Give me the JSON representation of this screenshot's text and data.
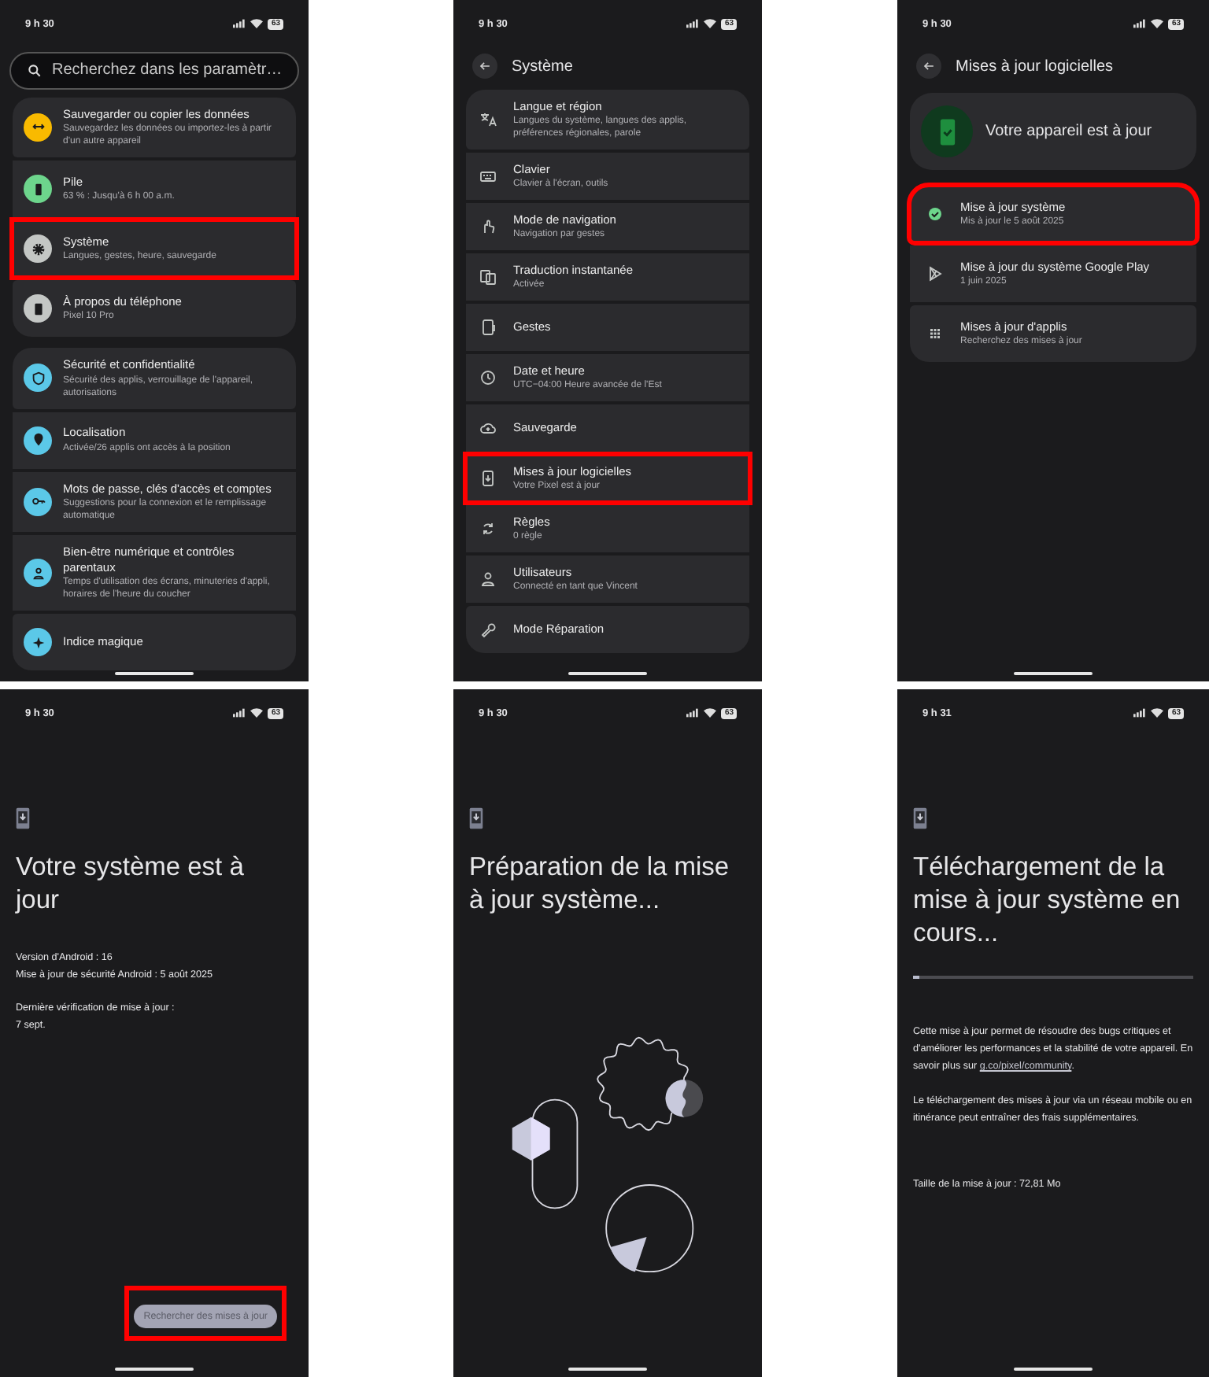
{
  "screens": [
    {
      "kind": "settings",
      "time": "9 h 30",
      "battery": "63",
      "search": {
        "placeholder": "Recherchez dans les paramètr…"
      },
      "groups": [
        {
          "items": [
            {
              "title": "Sauvegarder ou copier les données",
              "subtitle": "Sauvegardez les données ou importez-les à partir d'un autre appareil",
              "color": "#f9ba00",
              "highlighted": false
            },
            {
              "title": "Pile",
              "subtitle": "63 % : Jusqu'à 6 h 00 a.m.",
              "color": "#6dd58c",
              "highlighted": false
            },
            {
              "title": "Système",
              "subtitle": "Langues, gestes, heure, sauvegarde",
              "color": "#c4c7c5",
              "highlighted": true
            },
            {
              "title": "À propos du téléphone",
              "subtitle": "Pixel 10 Pro",
              "color": "#c4c7c5",
              "highlighted": false
            }
          ]
        },
        {
          "items": [
            {
              "title": "Sécurité et confidentialité",
              "subtitle": "Sécurité des applis, verrouillage de l'appareil, autorisations",
              "color": "#5bc8e8",
              "highlighted": false
            },
            {
              "title": "Localisation",
              "subtitle": "Activée/26 applis ont accès à la position",
              "color": "#5bc8e8",
              "highlighted": false
            },
            {
              "title": "Mots de passe, clés d'accès et comptes",
              "subtitle": "Suggestions pour la connexion et le remplissage automatique",
              "color": "#5bc8e8",
              "highlighted": false
            },
            {
              "title": "Bien-être numérique et contrôles parentaux",
              "subtitle": "Temps d'utilisation des écrans, minuteries d'appli, horaires de l'heure du coucher",
              "color": "#5bc8e8",
              "highlighted": false
            },
            {
              "title": "Indice magique",
              "color": "#5bc8e8",
              "highlighted": false
            }
          ]
        }
      ]
    },
    {
      "kind": "list",
      "time": "9 h 30",
      "battery": "63",
      "title": "Système",
      "items": [
        {
          "title": "Langue et région",
          "subtitle": "Langues du système, langues des applis, préférences régionales, parole",
          "highlighted": false
        },
        {
          "title": "Clavier",
          "subtitle": "Clavier à l'écran, outils",
          "highlighted": false
        },
        {
          "title": "Mode de navigation",
          "subtitle": "Navigation par gestes",
          "highlighted": false
        },
        {
          "title": "Traduction instantanée",
          "subtitle": "Activée",
          "highlighted": false
        },
        {
          "title": "Gestes",
          "highlighted": false
        },
        {
          "title": "Date et heure",
          "subtitle": "UTC−04:00 Heure avancée de l'Est",
          "highlighted": false
        },
        {
          "title": "Sauvegarde",
          "highlighted": false
        },
        {
          "title": "Mises à jour logicielles",
          "subtitle": "Votre Pixel est à jour",
          "highlighted": true
        },
        {
          "title": "Règles",
          "subtitle": "0 règle",
          "highlighted": false
        },
        {
          "title": "Utilisateurs",
          "subtitle": "Connecté en tant que Vincent",
          "highlighted": false
        },
        {
          "title": "Mode Réparation",
          "highlighted": false
        }
      ]
    },
    {
      "kind": "updates",
      "time": "9 h 30",
      "battery": "63",
      "title": "Mises à jour logicielles",
      "status": "Votre appareil est à jour",
      "items": [
        {
          "title": "Mise à jour système",
          "subtitle": "Mis à jour le 5 août 2025",
          "highlighted": true
        },
        {
          "title": "Mise à jour du système Google Play",
          "subtitle": "1 juin 2025",
          "highlighted": false
        },
        {
          "title": "Mises à jour d'applis",
          "subtitle": "Recherchez des mises à jour",
          "highlighted": false
        }
      ]
    },
    {
      "kind": "result",
      "time": "9 h 30",
      "battery": "63",
      "title": "Votre système est à jour",
      "info": [
        "Version d'Android : 16",
        "Mise à jour de sécurité Android : 5 août 2025"
      ],
      "last_check": [
        "Dernière vérification de mise à jour :",
        "7 sept."
      ],
      "button": {
        "label": "Rechercher des mises à jour",
        "disabled": true,
        "highlighted": true
      }
    },
    {
      "kind": "preparing",
      "time": "9 h 30",
      "battery": "63",
      "title": "Préparation de la mise à jour système..."
    },
    {
      "kind": "downloading",
      "time": "9 h 31",
      "battery": "63",
      "title": "Téléchargement de la mise à jour système en cours...",
      "progress": {
        "level": 0.02
      },
      "paragraphs": [
        {
          "text": "Cette mise à jour permet de résoudre des bugs critiques et d'améliorer les performances et la stabilité de votre appareil. En savoir plus sur ",
          "link": "g.co/pixel/community",
          "after": "."
        },
        {
          "text": "Le téléchargement des mises à jour via un réseau mobile ou en itinérance peut entraîner des frais supplémentaires."
        }
      ],
      "size": "Taille de la mise à jour : 72,81 Mo"
    }
  ]
}
